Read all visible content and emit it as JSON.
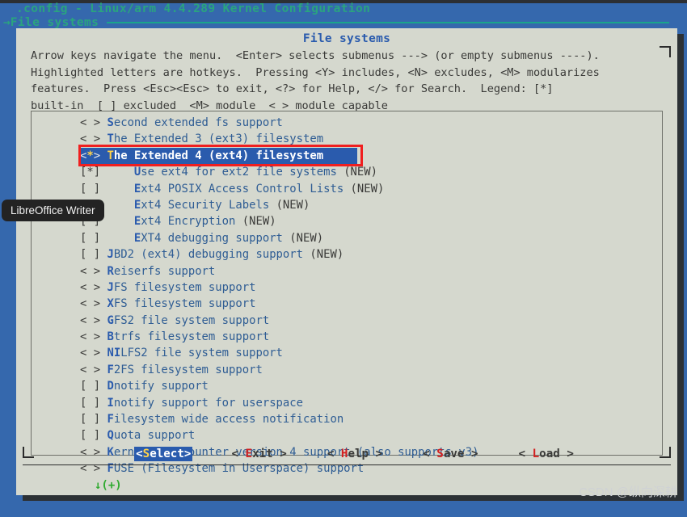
{
  "terminal": {
    "config_title": ".config - Linux/arm 4.4.289 Kernel Configuration",
    "breadcrumb_arrow": "→",
    "breadcrumb": "File systems"
  },
  "dialog": {
    "title": "File systems",
    "help_text": "Arrow keys navigate the menu.  <Enter> selects submenus ---> (or empty submenus ----).\nHighlighted letters are hotkeys.  Pressing <Y> includes, <N> excludes, <M> modularizes\nfeatures.  Press <Esc><Esc> to exit, <?> for Help, </> for Search.  Legend: [*]\nbuilt-in  [ ] excluded  <M> module  < > module capable",
    "scroll_indicator": "↓(+)"
  },
  "menu": {
    "items": [
      {
        "mark": "< >",
        "hot": "S",
        "label": "econd extended fs support",
        "tail": "",
        "indent": "",
        "selected": false
      },
      {
        "mark": "< >",
        "hot": "T",
        "label": "he Extended 3 (ext3) filesystem",
        "tail": "",
        "indent": "",
        "selected": false
      },
      {
        "mark": "<*>",
        "hot": "T",
        "label": "he Extended 4 (ext4) filesystem",
        "tail": "",
        "indent": "",
        "selected": true
      },
      {
        "mark": "[*]",
        "hot": "U",
        "label": "se ext4 for ext2 file systems",
        "tail": " (NEW)",
        "indent": "    ",
        "selected": false
      },
      {
        "mark": "[ ]",
        "hot": "E",
        "label": "xt4 POSIX Access Control Lists",
        "tail": " (NEW)",
        "indent": "    ",
        "selected": false
      },
      {
        "mark": "[ ]",
        "hot": "E",
        "label": "xt4 Security Labels",
        "tail": " (NEW)",
        "indent": "    ",
        "selected": false
      },
      {
        "mark": "[ ]",
        "hot": "E",
        "label": "xt4 Encryption",
        "tail": " (NEW)",
        "indent": "    ",
        "selected": false
      },
      {
        "mark": "[ ]",
        "hot": "E",
        "label": "XT4 debugging support",
        "tail": " (NEW)",
        "indent": "    ",
        "selected": false
      },
      {
        "mark": "[ ]",
        "hot": "J",
        "label": "BD2 (ext4) debugging support",
        "tail": " (NEW)",
        "indent": "",
        "selected": false
      },
      {
        "mark": "< >",
        "hot": "R",
        "label": "eiserfs support",
        "tail": "",
        "indent": "",
        "selected": false
      },
      {
        "mark": "< >",
        "hot": "J",
        "label": "FS filesystem support",
        "tail": "",
        "indent": "",
        "selected": false
      },
      {
        "mark": "< >",
        "hot": "X",
        "label": "FS filesystem support",
        "tail": "",
        "indent": "",
        "selected": false
      },
      {
        "mark": "< >",
        "hot": "G",
        "label": "FS2 file system support",
        "tail": "",
        "indent": "",
        "selected": false
      },
      {
        "mark": "< >",
        "hot": "B",
        "label": "trfs filesystem support",
        "tail": "",
        "indent": "",
        "selected": false
      },
      {
        "mark": "< >",
        "hot": "NI",
        "label": "LFS2 file system support",
        "tail": "",
        "indent": "",
        "selected": false
      },
      {
        "mark": "< >",
        "hot": "F",
        "label": "2FS filesystem support",
        "tail": "",
        "indent": "",
        "selected": false
      },
      {
        "mark": "[ ]",
        "hot": "D",
        "label": "notify support",
        "tail": "",
        "indent": "",
        "selected": false
      },
      {
        "mark": "[ ]",
        "hot": "I",
        "label": "notify support for userspace",
        "tail": "",
        "indent": "",
        "selected": false
      },
      {
        "mark": "[ ]",
        "hot": "F",
        "label": "ilesystem wide access notification",
        "tail": "",
        "indent": "",
        "selected": false
      },
      {
        "mark": "[ ]",
        "hot": "Q",
        "label": "uota support",
        "tail": "",
        "indent": "",
        "selected": false
      },
      {
        "mark": "< >",
        "hot": "K",
        "label": "ernel automounter version 4 support (also supports v3)",
        "tail": "",
        "indent": "",
        "selected": false
      },
      {
        "mark": "< >",
        "hot": "F",
        "label": "USE (Filesystem in Userspace) support",
        "tail": "",
        "indent": "",
        "selected": false
      }
    ]
  },
  "buttons": [
    {
      "left": "<",
      "hot": "S",
      "rest": "elect",
      "right": ">",
      "active": true
    },
    {
      "left": "< ",
      "hot": "E",
      "rest": "xit",
      "right": " >",
      "active": false
    },
    {
      "left": "< ",
      "hot": "H",
      "rest": "elp",
      "right": " >",
      "active": false
    },
    {
      "left": "< ",
      "hot": "S",
      "rest": "ave",
      "right": " >",
      "active": false
    },
    {
      "left": "< ",
      "hot": "L",
      "rest": "oad",
      "right": " >",
      "active": false
    }
  ],
  "tooltip": {
    "text": "LibreOffice Writer"
  },
  "watermark": {
    "text": "CSDN @纵向深耕"
  },
  "colors": {
    "desktop_blue": "#3568ad",
    "dialog_bg": "#d5d8ce",
    "accent_teal": "#2aa47f",
    "highlight_blue": "#2a5bad",
    "hotkey_yellow": "#ffd24a",
    "annotation_red": "#f01f1f",
    "scroll_green": "#2faa2f",
    "button_hotkey_red": "#d31f1f"
  }
}
